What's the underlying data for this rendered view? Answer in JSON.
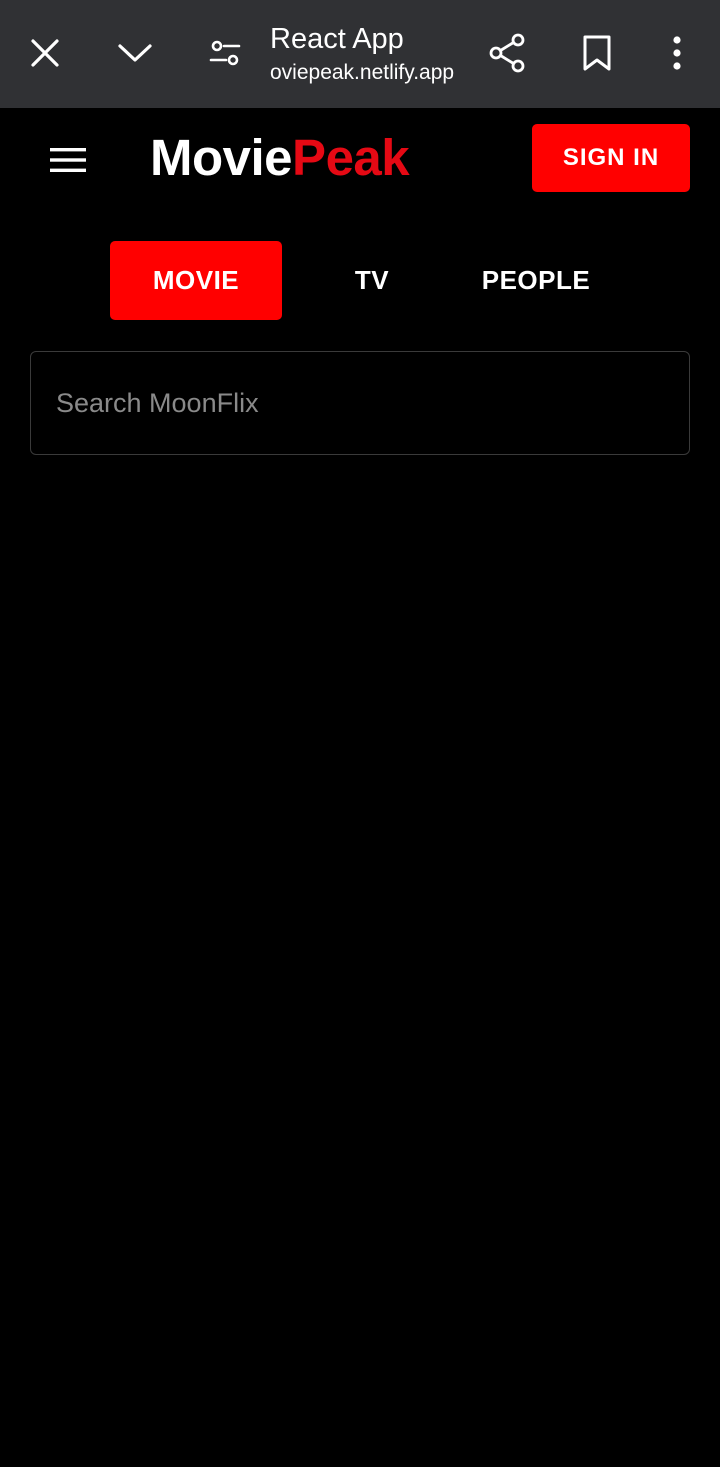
{
  "browser": {
    "page_title": "React App",
    "url": "oviepeak.netlify.app",
    "icons": [
      "close-icon",
      "chevron-down-icon",
      "tune-icon",
      "share-icon",
      "bookmark-icon",
      "more-vert-icon"
    ]
  },
  "header": {
    "logo_part1": "Movie",
    "logo_part2": "Peak",
    "signin_label": "SIGN IN",
    "accent_color": "#ff0000"
  },
  "tabs": [
    {
      "label": "MOVIE",
      "active": true
    },
    {
      "label": "TV",
      "active": false
    },
    {
      "label": "PEOPLE",
      "active": false
    }
  ],
  "search": {
    "placeholder": "Search MoonFlix",
    "value": ""
  }
}
